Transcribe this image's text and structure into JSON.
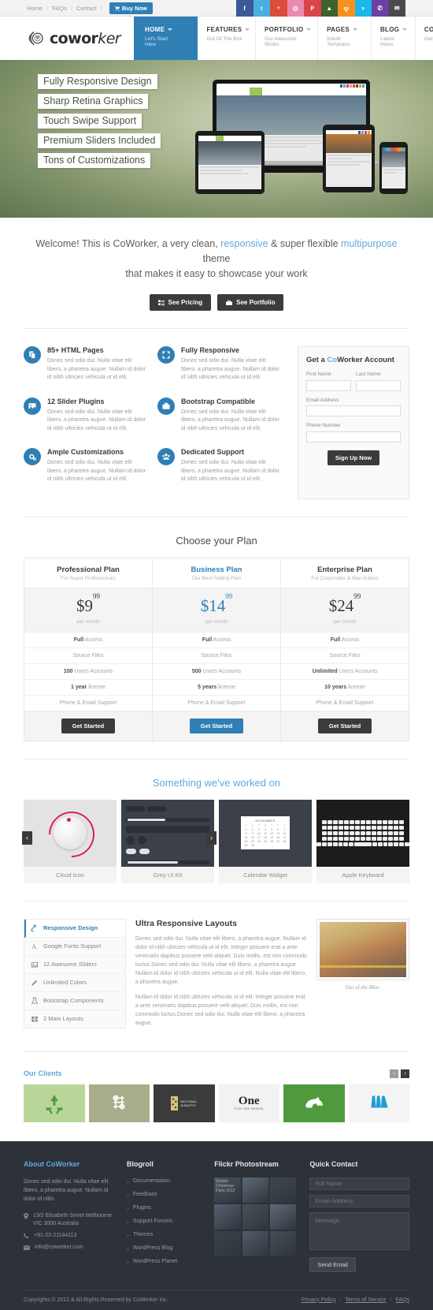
{
  "topbar": {
    "links": [
      "Home",
      "FAQs",
      "Contact"
    ],
    "separator": "/",
    "buy_now": "Buy Now",
    "socials": [
      {
        "name": "facebook-icon",
        "glyph": "f",
        "color": "#3b5998"
      },
      {
        "name": "twitter-icon",
        "glyph": "t",
        "color": "#4aafe0"
      },
      {
        "name": "google-plus-icon",
        "glyph": "+",
        "color": "#dd4b39"
      },
      {
        "name": "dribbble-icon",
        "glyph": "◎",
        "color": "#ea8ab0"
      },
      {
        "name": "pinterest-icon",
        "glyph": "P",
        "color": "#d9434a"
      },
      {
        "name": "android-icon",
        "glyph": "▲",
        "color": "#3f612d"
      },
      {
        "name": "rss-icon",
        "glyph": "ȹ",
        "color": "#f79020"
      },
      {
        "name": "vimeo-icon",
        "glyph": "v",
        "color": "#1ab7ea"
      },
      {
        "name": "phone-icon",
        "glyph": "✆",
        "color": "#6c3fa0"
      },
      {
        "name": "email-icon",
        "glyph": "✉",
        "color": "#4a4a4a"
      }
    ]
  },
  "header": {
    "logo_text_bold": "cowor",
    "logo_text_italic": "ker",
    "nav": [
      {
        "title": "HOME",
        "sub": "Let's Start Here",
        "active": true,
        "caret": true
      },
      {
        "title": "FEATURES",
        "sub": "Out Of The Box",
        "active": false,
        "caret": true
      },
      {
        "title": "PORTFOLIO",
        "sub": "Our Awesome Works",
        "active": false,
        "caret": true
      },
      {
        "title": "PAGES",
        "sub": "Inbuilt Templates",
        "active": false,
        "caret": true
      },
      {
        "title": "BLOG",
        "sub": "Latest News",
        "active": false,
        "caret": true
      },
      {
        "title": "CONTACT",
        "sub": "Get In Touch",
        "active": false,
        "caret": false
      }
    ]
  },
  "hero": {
    "tags": [
      "Fully Responsive Design",
      "Sharp Retina Graphics",
      "Touch Swipe Support",
      "Premium Sliders Included",
      "Tons of Customizations"
    ]
  },
  "welcome": {
    "line1_a": "Welcome! This is CoWorker, a very clean, ",
    "link1": "responsive",
    "line1_b": " & super flexible ",
    "link2": "multipurpose",
    "line1_c": " theme",
    "line2": "that makes it easy to showcase your work",
    "btn_pricing": "See Pricing",
    "btn_portfolio": "See Portfolio"
  },
  "features": {
    "body": "Donec sed odio dui. Nulla vitae elit libero, a pharetra augue. Nullam id dolor id nibh ultricies vehicula ut id elit.",
    "items": [
      {
        "title": "85+ HTML Pages",
        "icon": "pages-icon"
      },
      {
        "title": "Fully Responsive",
        "icon": "expand-arrows-icon"
      },
      {
        "title": "12 Slider Plugins",
        "icon": "image-icon"
      },
      {
        "title": "Bootstrap Compatible",
        "icon": "briefcase-icon"
      },
      {
        "title": "Ample Customizations",
        "icon": "gears-icon"
      },
      {
        "title": "Dedicated Support",
        "icon": "users-icon"
      }
    ]
  },
  "signup": {
    "title_a": "Get a ",
    "title_hi": "Co",
    "title_b": "Worker Account",
    "first_name_label": "First Name",
    "last_name_label": "Last Name",
    "email_label": "Email Address",
    "phone_label": "Phone Number",
    "first_name_value": "",
    "last_name_value": "",
    "email_value": "",
    "phone_value": "",
    "button": "Sign Up Now"
  },
  "pricing": {
    "title_a": "Choose your Plan",
    "plans": [
      {
        "name": "Professional Plan",
        "sub": "For Super Professionals",
        "price": "$9",
        "cents": "99",
        "per": "per month",
        "featured": false,
        "features": [
          {
            "b": "Full",
            "t": " Access"
          },
          {
            "b": "",
            "t": "Source Files"
          },
          {
            "b": "100",
            "t": " Users Accounts"
          },
          {
            "b": "1 year",
            "t": " license"
          },
          {
            "b": "",
            "t": "Phone & Email Support"
          }
        ],
        "cta": "Get Started"
      },
      {
        "name": "Business Plan",
        "sub": "Our Best-Selling Plan",
        "price": "$14",
        "cents": "99",
        "per": "per month",
        "featured": true,
        "features": [
          {
            "b": "Full",
            "t": " Access"
          },
          {
            "b": "",
            "t": "Source Files"
          },
          {
            "b": "500",
            "t": " Users Accounts"
          },
          {
            "b": "5 years",
            "t": " license"
          },
          {
            "b": "",
            "t": "Phone & Email Support"
          }
        ],
        "cta": "Get Started"
      },
      {
        "name": "Enterprise Plan",
        "sub": "For Corporates & Man-Eaters",
        "price": "$24",
        "cents": "99",
        "per": "per month",
        "featured": false,
        "features": [
          {
            "b": "Full",
            "t": " Access"
          },
          {
            "b": "",
            "t": "Source Files"
          },
          {
            "b": "Unlimited",
            "t": " Users Accounts"
          },
          {
            "b": "10 years",
            "t": " license"
          },
          {
            "b": "",
            "t": "Phone & Email Support"
          }
        ],
        "cta": "Get Started"
      }
    ]
  },
  "portfolio": {
    "title_a": "Something we've ",
    "title_hi": "worked",
    "title_b": " on",
    "items": [
      {
        "caption": "Cloud Icon"
      },
      {
        "caption": "Grey UI Kit"
      },
      {
        "caption": "Calendar Widget"
      },
      {
        "caption": "Apple Keyboard"
      }
    ],
    "prev": "‹",
    "next": "›",
    "calendar_month": "NOVEMBER"
  },
  "tabs": {
    "items": [
      {
        "label": "Responsive Design",
        "icon": "resize-icon",
        "active": true
      },
      {
        "label": "Google Fonts Support",
        "icon": "font-icon",
        "active": false
      },
      {
        "label": "12 Awesome Sliders",
        "icon": "slider-image-icon",
        "active": false
      },
      {
        "label": "Unlimited Colors",
        "icon": "pencil-icon",
        "active": false
      },
      {
        "label": "Bootstrap Components",
        "icon": "flask-icon",
        "active": false
      },
      {
        "label": "2 Main Layouts",
        "icon": "grid-icon",
        "active": false
      }
    ],
    "heading": "Ultra Responsive Layouts",
    "para1": "Donec sed odio dui. Nulla vitae elit libero, a pharetra augue. Nullam id dolor id nibh ultricies vehicula ut id elit. Integer posuere erat a ante venenatis dapibus posuere velit aliquet. Duis mollis, est non commodo luctus.Donec sed odio dui. Nulla vitae elit libero, a pharetra augue. Nullam id dolor id nibh ultricies vehicula ut id elit. Nulla vitae elit libero, a pharetra augue.",
    "para2": "Nullam id dolor id nibh ultricies vehicula ut id elit. Integer posuere erat a ante venenatis dapibus posuere velit aliquet. Duis mollis, est non commodo luctus.Donec sed odio dui. Nulla vitae elit libero, a pharetra augue.",
    "image_caption": "Out of the Blue."
  },
  "clients": {
    "title_a": "Our ",
    "title_hi": "Clients",
    "prev": "‹",
    "next": "›",
    "logos": [
      {
        "name": "recycle-logo",
        "label": "",
        "bg": "#b9d69a",
        "fg": "#4f9a3c"
      },
      {
        "name": "knot-logo",
        "label": "",
        "bg": "#a8ad8c",
        "fg": "#ffffff"
      },
      {
        "name": "national-giraffic-logo",
        "label": "NATIONAL GIRAFFIC",
        "bg": "#3b3b3b",
        "fg": "#d8c479"
      },
      {
        "name": "one-logo",
        "label": "One",
        "bg": "#f2f2f2",
        "fg": "#222222"
      },
      {
        "name": "rhino-logo",
        "label": "",
        "bg": "#4f9a3c",
        "fg": "#ffffff"
      },
      {
        "name": "pillars-logo",
        "label": "",
        "bg": "#f4f4f4",
        "fg": "#1f9ed4"
      }
    ]
  },
  "footer": {
    "about": {
      "title_a": "About ",
      "title_hi": "Co",
      "title_b": "Worker",
      "text": "Donec sed odio dui. Nulla vitae elit libero, a pharetra augue. Nullam id dolor id nibh.",
      "address": "13/2 Elizabeth Street Melbourne VIC 3000 Australia",
      "phone": "+91-22-21144113",
      "email": "info@coworker.com"
    },
    "blogroll": {
      "title": "Blogroll",
      "items": [
        "Documentation",
        "Feedback",
        "Plugins",
        "Support Forums",
        "Themes",
        "WordPress Blog",
        "WordPress Planet"
      ]
    },
    "flickr": {
      "title": "Flickr Photostream",
      "overlay": "Envato Christmas Party 2012"
    },
    "contact": {
      "title": "Quick Contact",
      "name_placeholder": "Full Name",
      "email_placeholder": "Email Address",
      "message_placeholder": "Message",
      "button": "Send Email"
    },
    "copyright": "Copyrights © 2012 & All Rights Reserved by CoWorker Inc.",
    "links": [
      "Privacy Policy",
      "Terms of Service",
      "FAQs"
    ],
    "link_sep": "/"
  }
}
